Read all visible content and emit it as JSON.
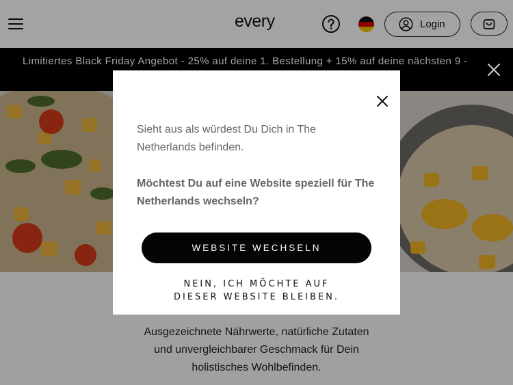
{
  "header": {
    "logo": "every",
    "login_label": "Login",
    "icons": [
      "menu-icon",
      "help-icon",
      "german-flag-icon",
      "user-icon",
      "cart-icon"
    ]
  },
  "banner": {
    "text": "Limitiertes Black Friday Angebot - 25% auf deine 1. Bestellung + 15% auf deine nächsten 9 -"
  },
  "main": {
    "description": [
      "Ausgezeichnete Nährwerte, natürliche Zutaten",
      "und unvergleichbarer Geschmack für Dein",
      "holistisches Wohlbefinden."
    ]
  },
  "modal": {
    "message_line1": "Sieht aus als würdest Du Dich in The",
    "message_line2": "Netherlands befinden.",
    "question_line1": "Möchtest Du auf eine Website speziell für The",
    "question_line2": "Netherlands wechseln?",
    "switch_button": "WEBSITE WECHSELN",
    "stay_line1": "NEIN, ICH MÖCHTE AUF",
    "stay_line2": "DIESER WEBSITE BLEIBEN."
  },
  "colors": {
    "banner_bg": "#000000",
    "primary_button": "#050505",
    "overlay": "rgba(0,0,0,0.36)"
  }
}
